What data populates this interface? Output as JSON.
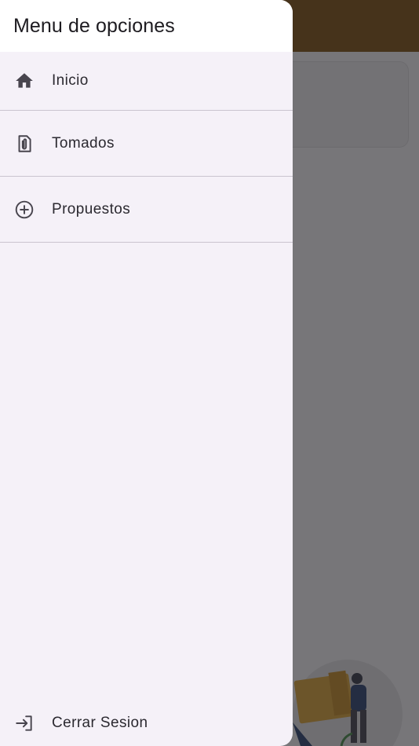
{
  "colors": {
    "app_bar": "#7a4a00",
    "drawer_background": "#f5f1f8",
    "drawer_header": "#ffffff",
    "divider": "#cac4cf",
    "text": "#2b2930",
    "scrim": "rgba(40,38,42,0.63)"
  },
  "drawer": {
    "title": "Menu de opciones",
    "items": [
      {
        "label": "Inicio",
        "icon": "home-icon"
      },
      {
        "label": "Tomados",
        "icon": "attachment-file-icon"
      },
      {
        "label": "Propuestos",
        "icon": "add-circle-icon"
      }
    ],
    "logout": {
      "label": "Cerrar Sesion",
      "icon": "login-arrow-icon"
    }
  }
}
